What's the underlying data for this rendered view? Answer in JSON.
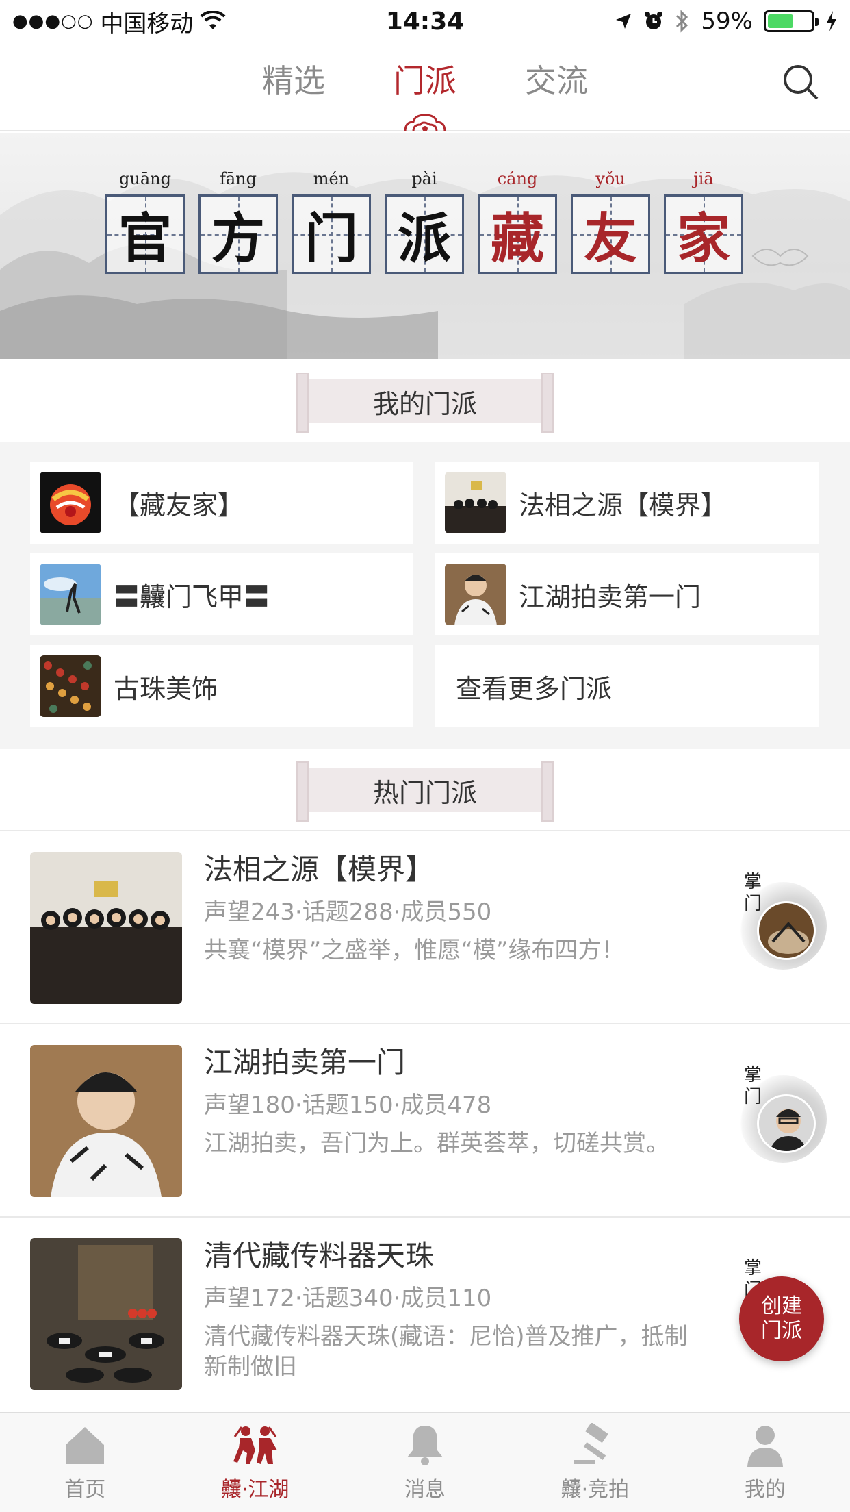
{
  "status_bar": {
    "carrier": "中国移动",
    "signal_dots": "●●●○○",
    "time": "14:34",
    "battery_percent": "59%",
    "battery_level": 0.59
  },
  "top_tabs": [
    {
      "label": "精选",
      "active": false
    },
    {
      "label": "门派",
      "active": true
    },
    {
      "label": "交流",
      "active": false
    }
  ],
  "banner": {
    "chars": [
      {
        "char": "官",
        "pinyin": "guāng",
        "red": false
      },
      {
        "char": "方",
        "pinyin": "fāng",
        "red": false
      },
      {
        "char": "门",
        "pinyin": "mén",
        "red": false
      },
      {
        "char": "派",
        "pinyin": "pài",
        "red": false
      },
      {
        "char": "藏",
        "pinyin": "cáng",
        "red": true
      },
      {
        "char": "友",
        "pinyin": "yǒu",
        "red": true
      },
      {
        "char": "家",
        "pinyin": "jiā",
        "red": true
      }
    ]
  },
  "my_sects": {
    "title": "我的门派",
    "items": [
      {
        "name": "【藏友家】"
      },
      {
        "name": "法相之源【模界】"
      },
      {
        "name": "〓齉门飞甲〓"
      },
      {
        "name": "江湖拍卖第一门"
      },
      {
        "name": "古珠美饰"
      }
    ],
    "more_label": "查看更多门派"
  },
  "hot_sects": {
    "title": "热门门派",
    "items": [
      {
        "title": "法相之源【模界】",
        "stats": "声望243·话题288·成员550",
        "desc": "共襄“模界”之盛举，惟愿“模”缘布四方！"
      },
      {
        "title": "江湖拍卖第一门",
        "stats": "声望180·话题150·成员478",
        "desc": "江湖拍卖，吾门为上。群英荟萃，切磋共赏。"
      },
      {
        "title": "清代藏传料器天珠",
        "stats": "声望172·话题340·成员110",
        "desc": "清代藏传料器天珠(藏语：尼恰)普及推广，抵制新制做旧"
      }
    ],
    "master_label": "掌门"
  },
  "fab": {
    "label_line1": "创建",
    "label_line2": "门派"
  },
  "tab_bar": [
    {
      "label": "首页",
      "icon": "home-icon",
      "active": false
    },
    {
      "label": "齉·江湖",
      "icon": "warriors-icon",
      "active": true
    },
    {
      "label": "消息",
      "icon": "bell-icon",
      "active": false
    },
    {
      "label": "齉·竞拍",
      "icon": "gavel-icon",
      "active": false
    },
    {
      "label": "我的",
      "icon": "person-icon",
      "active": false
    }
  ],
  "colors": {
    "accent": "#a8262a",
    "muted": "#9a9a9a",
    "battery": "#4cd964"
  }
}
